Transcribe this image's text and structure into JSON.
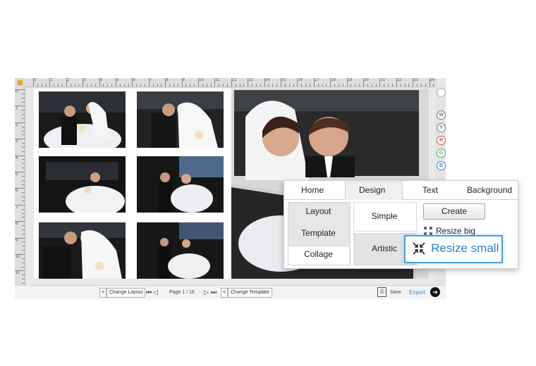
{
  "ruler": {
    "top_ticks": [
      "0",
      "1",
      "2",
      "3",
      "4",
      "5",
      "6",
      "7",
      "8",
      "9",
      "10",
      "11",
      "12",
      "13",
      "14",
      "15",
      "16",
      "17",
      "18",
      "19",
      "20",
      "21",
      "22",
      "23",
      "24"
    ],
    "left_ticks": [
      "0",
      "1",
      "2",
      "3",
      "4",
      "5",
      "6",
      "7",
      "8",
      "9",
      "10",
      "11"
    ]
  },
  "side_icons": [
    "W",
    "Y",
    "R",
    "G",
    "B"
  ],
  "toolbar": {
    "change_layout": "Change Layout",
    "page_info": "Page 1 / 16",
    "change_template": "Change Template",
    "save": "Save",
    "export": "Export",
    "prev_arrow": "<",
    "prev_arrow2": "<"
  },
  "panel": {
    "tabs": [
      "Home",
      "Design",
      "Text",
      "Background"
    ],
    "active_tab": "Design",
    "left_menu": [
      "Layout",
      "Template",
      "Collage"
    ],
    "styles": [
      "Simple",
      "Artistic"
    ],
    "create": "Create",
    "resize_big": "Resize big",
    "resize_small": "Resize small"
  },
  "colors": {
    "accent": "#4a9fe0",
    "export": "#3b8fd6",
    "ruler_icon": "#e8a23c"
  }
}
